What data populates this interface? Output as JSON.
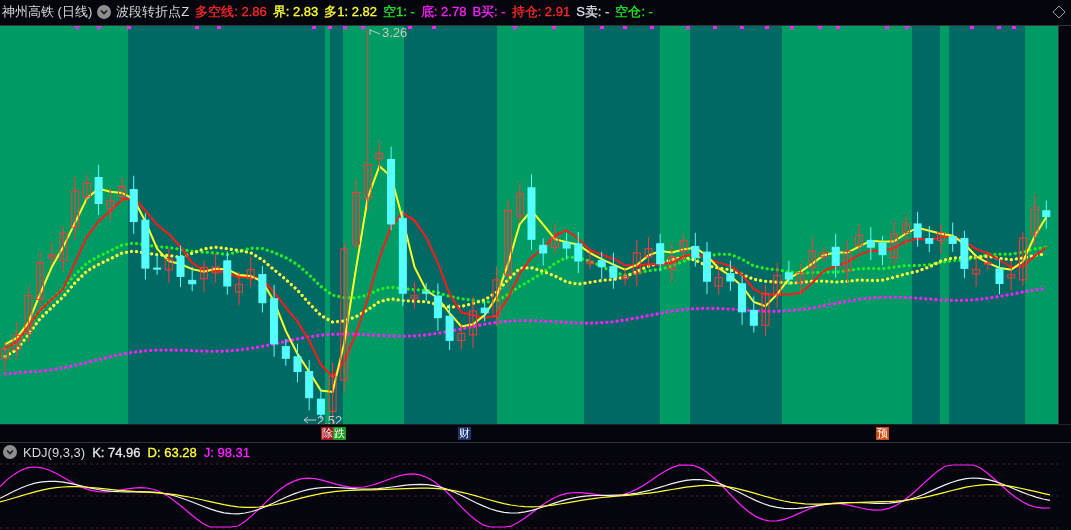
{
  "header": {
    "stock_title": "神州高铁 (日线)",
    "indicator": "波段转折点Z",
    "values": [
      {
        "label": "多空线:",
        "value": "2.86",
        "color": "#ff2a2a"
      },
      {
        "label": "界:",
        "value": "2.83",
        "color": "#ffff33"
      },
      {
        "label": "多1:",
        "value": "2.82",
        "color": "#ffff33"
      },
      {
        "label": "空1:",
        "value": "-",
        "color": "#22ee22"
      },
      {
        "label": "底:",
        "value": "2.78",
        "color": "#ff22ff"
      },
      {
        "label": "B买:",
        "value": "-",
        "color": "#ff22ff"
      },
      {
        "label": "持仓:",
        "value": "2.91",
        "color": "#ff2a2a"
      },
      {
        "label": "S卖:",
        "value": "-",
        "color": "#dddddd"
      },
      {
        "label": "空仓:",
        "value": "-",
        "color": "#22ee22"
      }
    ]
  },
  "chart": {
    "high_label": "3.26",
    "low_label": "2.52"
  },
  "markers": [
    {
      "text": "除",
      "color": "#a8141c"
    },
    {
      "text": "跌",
      "color": "#1c9a1c"
    },
    {
      "text": "财",
      "color": "#1a3470"
    },
    {
      "text": "预",
      "color": "#c84c10"
    }
  ],
  "kdj": {
    "name": "KDJ(9,3,3)",
    "values": [
      {
        "label": "K:",
        "value": "74.96",
        "color": "#e8e8e8"
      },
      {
        "label": "D:",
        "value": "63.28",
        "color": "#ffff33"
      },
      {
        "label": "J:",
        "value": "98.31",
        "color": "#ff22ff"
      }
    ]
  }
}
